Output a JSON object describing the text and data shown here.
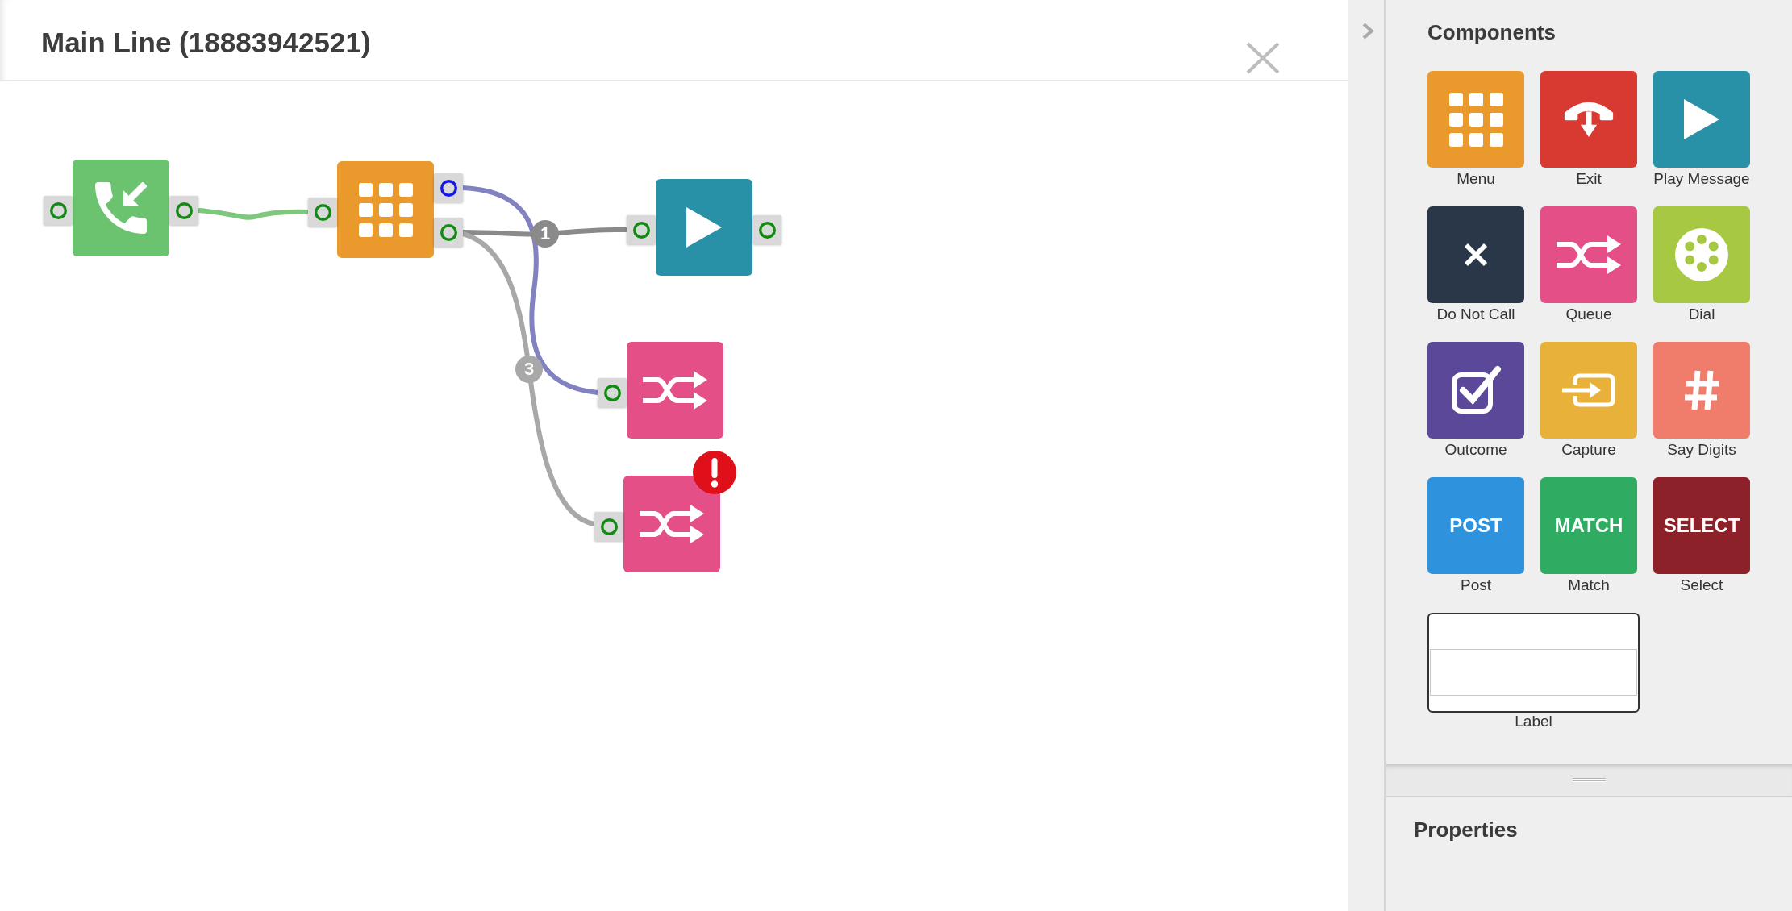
{
  "window": {
    "title": "Main Line (18883942521)"
  },
  "canvas": {
    "nodes": [
      {
        "kind": "incoming-call",
        "color": "#6cc36f",
        "error": false,
        "inputs": [
          {
            "selected": false
          }
        ],
        "outputs": [
          {
            "selected": false
          }
        ]
      },
      {
        "kind": "menu",
        "color": "#ea992d",
        "error": false,
        "inputs": [
          {
            "selected": false
          }
        ],
        "outputs": [
          {
            "selected": true
          },
          {
            "selected": false
          }
        ]
      },
      {
        "kind": "play-message",
        "color": "#2891a8",
        "error": false,
        "inputs": [
          {
            "selected": false
          }
        ],
        "outputs": [
          {
            "selected": false
          }
        ]
      },
      {
        "kind": "queue",
        "color": "#e54f88",
        "error": false,
        "inputs": [
          {
            "selected": false
          }
        ]
      },
      {
        "kind": "queue",
        "color": "#e54f88",
        "error": true,
        "inputs": [
          {
            "selected": false
          }
        ]
      }
    ],
    "connections": [
      {
        "color": "#7ec87e"
      },
      {
        "color": "#8282c0"
      },
      {
        "color": "#8a8a8a",
        "label": "1"
      },
      {
        "color": "#a8a8a8",
        "label": "3"
      }
    ]
  },
  "sidebar": {
    "components": {
      "title": "Components",
      "items": [
        {
          "label": "Menu",
          "kind": "menu",
          "color": "#ea992d"
        },
        {
          "label": "Exit",
          "kind": "exit",
          "color": "#d83a31"
        },
        {
          "label": "Play Message",
          "kind": "play-message",
          "color": "#2891a8"
        },
        {
          "label": "Do Not Call",
          "kind": "do-not-call",
          "color": "#2a3749"
        },
        {
          "label": "Queue",
          "kind": "queue",
          "color": "#e54f88"
        },
        {
          "label": "Dial",
          "kind": "dial",
          "color": "#a7c843"
        },
        {
          "label": "Outcome",
          "kind": "outcome",
          "color": "#5c4899"
        },
        {
          "label": "Capture",
          "kind": "capture",
          "color": "#e8b23a"
        },
        {
          "label": "Say Digits",
          "kind": "say-digits",
          "color": "#f07d6c"
        },
        {
          "label": "Post",
          "kind": "text",
          "tile_text": "POST",
          "color": "#2e92dc"
        },
        {
          "label": "Match",
          "kind": "text",
          "tile_text": "MATCH",
          "color": "#2fac62"
        },
        {
          "label": "Select",
          "kind": "text",
          "tile_text": "SELECT",
          "color": "#8c2129"
        },
        {
          "label": "Label",
          "kind": "label"
        }
      ]
    },
    "properties": {
      "title": "Properties"
    }
  }
}
